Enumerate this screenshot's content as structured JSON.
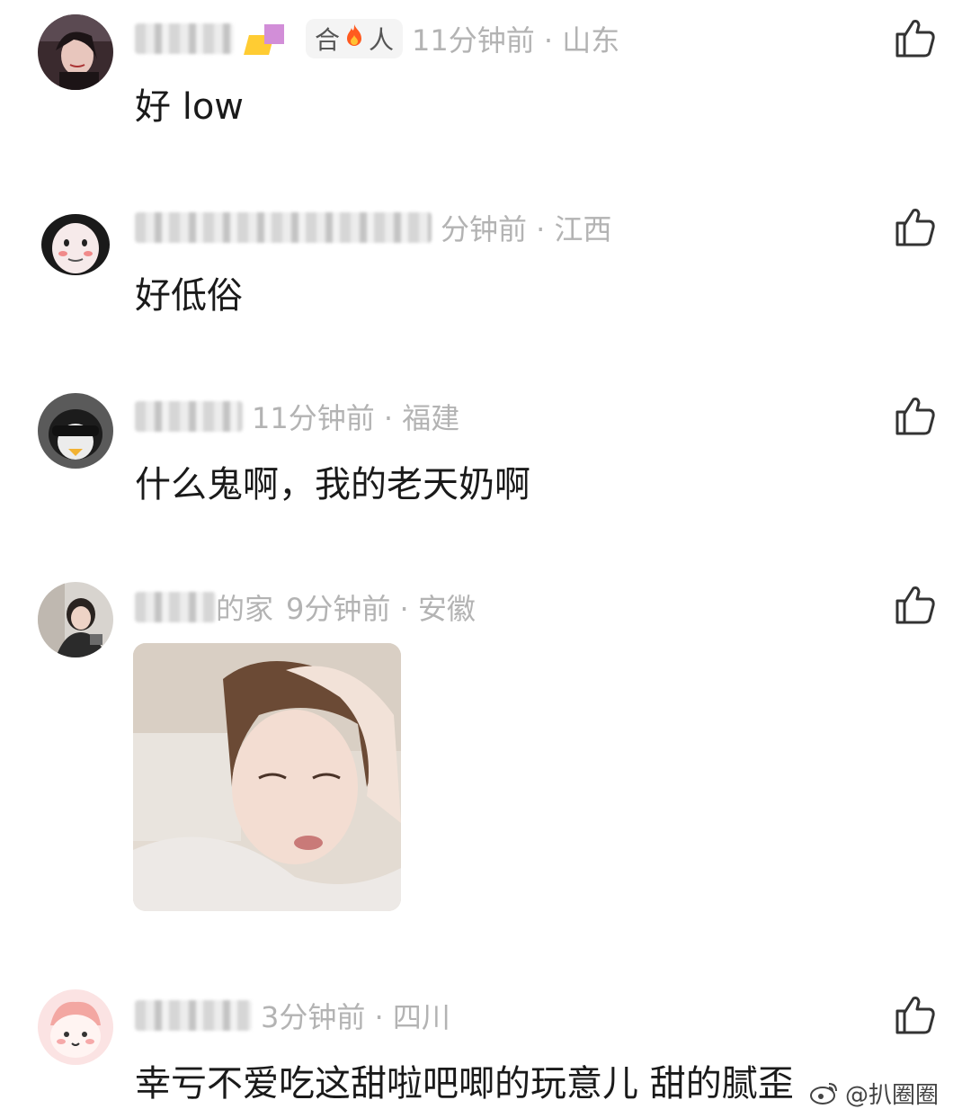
{
  "comments": [
    {
      "badge_prefix": "合",
      "badge_icon": "fire-icon",
      "badge_suffix": "人",
      "time_location": "11分钟前 · 山东",
      "text": "好 low"
    },
    {
      "time_location": "分钟前 · 江西",
      "text": "好低俗"
    },
    {
      "time_location": "11分钟前 · 福建",
      "text": "什么鬼啊，我的老天奶啊"
    },
    {
      "name_partial": "的家",
      "time_location": "9分钟前 · 安徽",
      "has_photo": true
    },
    {
      "time_location": "3分钟前 · 四川",
      "text": "幸亏不爱吃这甜啦吧唧的玩意儿 甜的腻歪"
    }
  ],
  "watermark": {
    "text": "@扒圈圈",
    "icon": "weibo-icon"
  },
  "colors": {
    "meta_gray": "#b3b3b3",
    "text": "#1a1a1a",
    "fire": "#ff5a1f"
  }
}
